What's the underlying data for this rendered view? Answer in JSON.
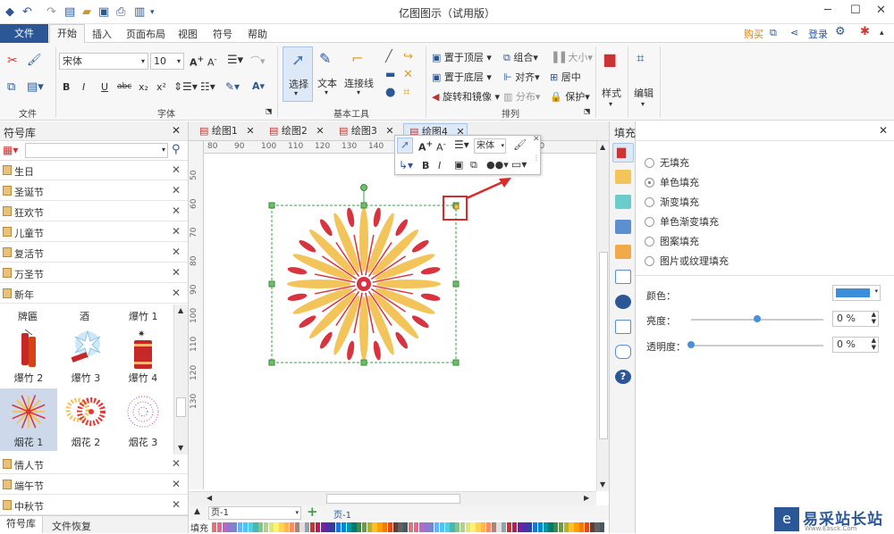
{
  "app": {
    "title": "亿图图示（试用版）",
    "buy": "购买",
    "login": "登录"
  },
  "menu": {
    "file": "文件",
    "items": [
      "开始",
      "插入",
      "页面布局",
      "视图",
      "符号",
      "帮助"
    ]
  },
  "ribbon": {
    "font_name": "宋体",
    "font_size": "10",
    "groups": {
      "file": "文件",
      "font": "字体",
      "basic_tools": "基本工具",
      "arrange": "排列"
    },
    "tools": {
      "select": "选择",
      "text": "文本",
      "connector": "连接线",
      "style": "样式",
      "edit": "编辑"
    },
    "arrange": {
      "bring_front": "置于顶层",
      "send_back": "置于底层",
      "rotate_mirror": "旋转和镜像",
      "group": "组合",
      "align": "对齐",
      "distribute": "分布",
      "size": "大小",
      "center": "居中",
      "protect": "保护"
    }
  },
  "library": {
    "title": "符号库",
    "categories": [
      {
        "label": "生日"
      },
      {
        "label": "圣诞节"
      },
      {
        "label": "狂欢节"
      },
      {
        "label": "儿童节"
      },
      {
        "label": "复活节"
      },
      {
        "label": "万圣节"
      },
      {
        "label": "新年"
      }
    ],
    "symbols_top_row": [
      "牌匾",
      "酒",
      "爆竹 1"
    ],
    "symbols": [
      {
        "label": "爆竹 2"
      },
      {
        "label": "爆竹 3"
      },
      {
        "label": "爆竹 4"
      },
      {
        "label": "烟花 1"
      },
      {
        "label": "烟花 2"
      },
      {
        "label": "烟花 3"
      }
    ],
    "categories_bottom": [
      {
        "label": "情人节"
      },
      {
        "label": "端午节"
      },
      {
        "label": "中秋节"
      }
    ],
    "bottom_tabs": [
      "符号库",
      "文件恢复"
    ]
  },
  "document_tabs": [
    "绘图1",
    "绘图2",
    "绘图3",
    "绘图4"
  ],
  "ruler_h_ticks": [
    "80",
    "90",
    "100",
    "110",
    "120",
    "130",
    "140",
    "",
    "",
    "",
    "",
    "200",
    "210"
  ],
  "ruler_v_ticks": [
    "50",
    "60",
    "70",
    "80",
    "90",
    "100",
    "110",
    "120",
    "130"
  ],
  "floating_toolbar": {
    "font_value": "宋体"
  },
  "page_bar": {
    "page_select": "页-1",
    "page_tab": "页-1",
    "fill_label": "填充"
  },
  "fill_panel": {
    "title": "填充",
    "options": [
      "无填充",
      "单色填充",
      "渐变填充",
      "单色渐变填充",
      "图案填充",
      "图片或纹理填充"
    ],
    "selected_option": "单色填充",
    "color_label": "颜色：",
    "brightness_label": "亮度：",
    "brightness_value": "0 %",
    "brightness_level": 0.5,
    "transparency_label": "透明度：",
    "transparency_value": "0 %",
    "transparency_level": 0.0,
    "color_value": "#3a8fd8"
  },
  "watermark": {
    "text": "易采站长站",
    "sub": "Www.Easck.Com"
  },
  "colors": {
    "accent": "#2b5797",
    "firework_yellow": "#f2c45a",
    "firework_red": "#d9333f",
    "highlight_box": "#d92b2b",
    "selection_green": "#3aa546"
  }
}
